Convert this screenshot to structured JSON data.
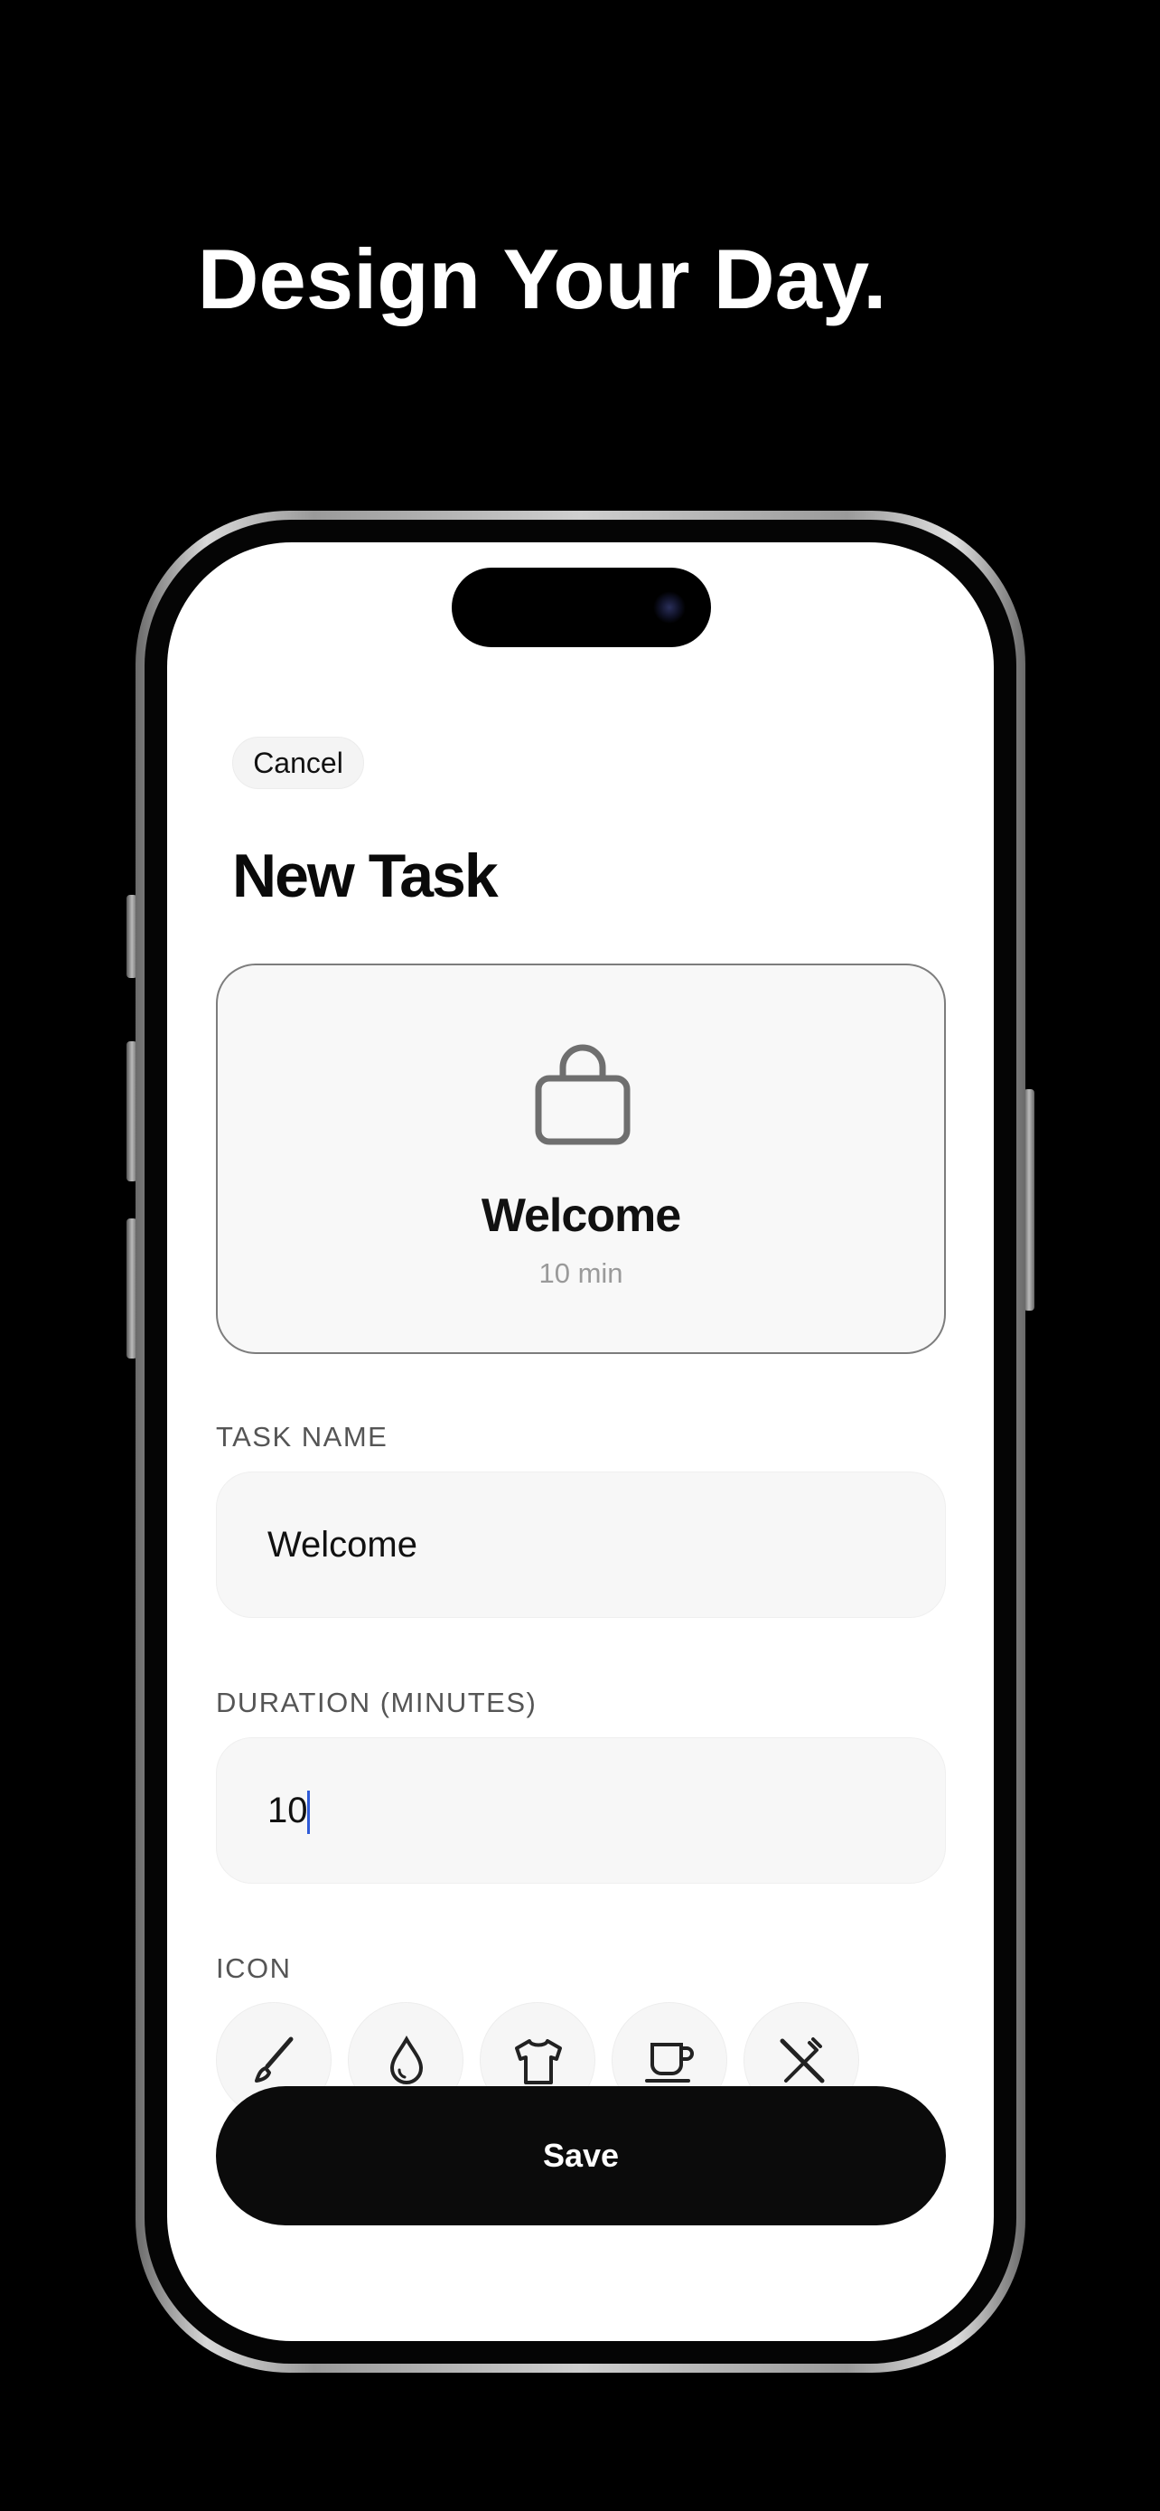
{
  "headline": "Design Your Day.",
  "header": {
    "cancel_label": "Cancel",
    "title": "New Task"
  },
  "preview": {
    "icon": "shopping-bag-icon",
    "name": "Welcome",
    "duration": "10 min"
  },
  "form": {
    "task_name_label": "TASK NAME",
    "task_name_value": "Welcome",
    "duration_label": "DURATION (MINUTES)",
    "duration_value": "10",
    "icon_label": "ICON",
    "icons": [
      "paintbrush-icon",
      "drop-icon",
      "tshirt-icon",
      "cup-icon",
      "fork-knife-icon"
    ]
  },
  "save_label": "Save",
  "colors": {
    "background": "#000000",
    "screen": "#ffffff",
    "primary_button": "#0b0b0b",
    "caret": "#2f5bd8"
  }
}
